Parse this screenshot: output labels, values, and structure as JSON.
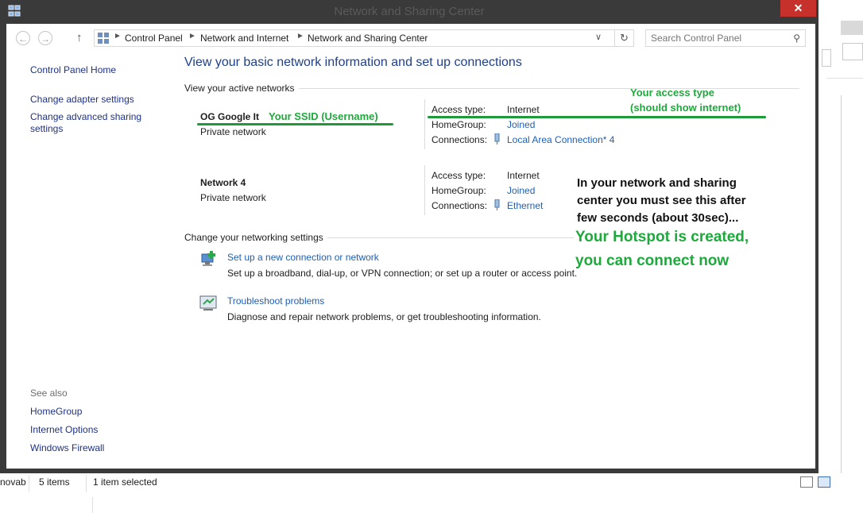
{
  "window": {
    "title": "Network and Sharing Center",
    "close_glyph": "✕"
  },
  "nav": {
    "back_glyph": "←",
    "forward_glyph": "→",
    "up_glyph": "↑",
    "breadcrumb": [
      "Control Panel",
      "Network and Internet",
      "Network and Sharing Center"
    ],
    "crumb_sep": "►",
    "dropdown_glyph": "∨",
    "refresh_glyph": "↻",
    "search_placeholder": "Search Control Panel",
    "search_glyph": "⚲"
  },
  "left_pane": {
    "home": "Control Panel Home",
    "links": [
      "Change adapter settings",
      "Change advanced sharing settings"
    ],
    "see_also_label": "See also",
    "see_also": [
      "HomeGroup",
      "Internet Options",
      "Windows Firewall"
    ]
  },
  "main": {
    "heading": "View your basic network information and set up connections",
    "active_networks_label": "View your active networks",
    "networks": [
      {
        "name": "OG Google It",
        "type": "Private network",
        "access_label": "Access type:",
        "access": "Internet",
        "homegroup_label": "HomeGroup:",
        "homegroup": "Joined",
        "connections_label": "Connections:",
        "connection": "Local Area Connection* 4"
      },
      {
        "name": "Network  4",
        "type": "Private network",
        "access_label": "Access type:",
        "access": "Internet",
        "homegroup_label": "HomeGroup:",
        "homegroup": "Joined",
        "connections_label": "Connections:",
        "connection": "Ethernet"
      }
    ],
    "change_settings_label": "Change your networking settings",
    "tasks": [
      {
        "title": "Set up a new connection or network",
        "desc": "Set up a broadband, dial-up, or VPN connection; or set up a router or access point."
      },
      {
        "title": "Troubleshoot problems",
        "desc": "Diagnose and repair network problems, or get troubleshooting information."
      }
    ]
  },
  "annotations": {
    "ssid": "Your SSID (Username)",
    "access_line1": "Your access type",
    "access_line2": "(should show internet)",
    "note_line1": "In your network and sharing",
    "note_line2": "center you must see this after",
    "note_line3": "few seconds (about 30sec)...",
    "created_line1": "Your Hotspot is created,",
    "created_line2": "you can connect now",
    "color": "#1fa83c"
  },
  "background_window": {
    "left_fragment": "novab",
    "items_count": "5 items",
    "selected": "1 item selected"
  }
}
